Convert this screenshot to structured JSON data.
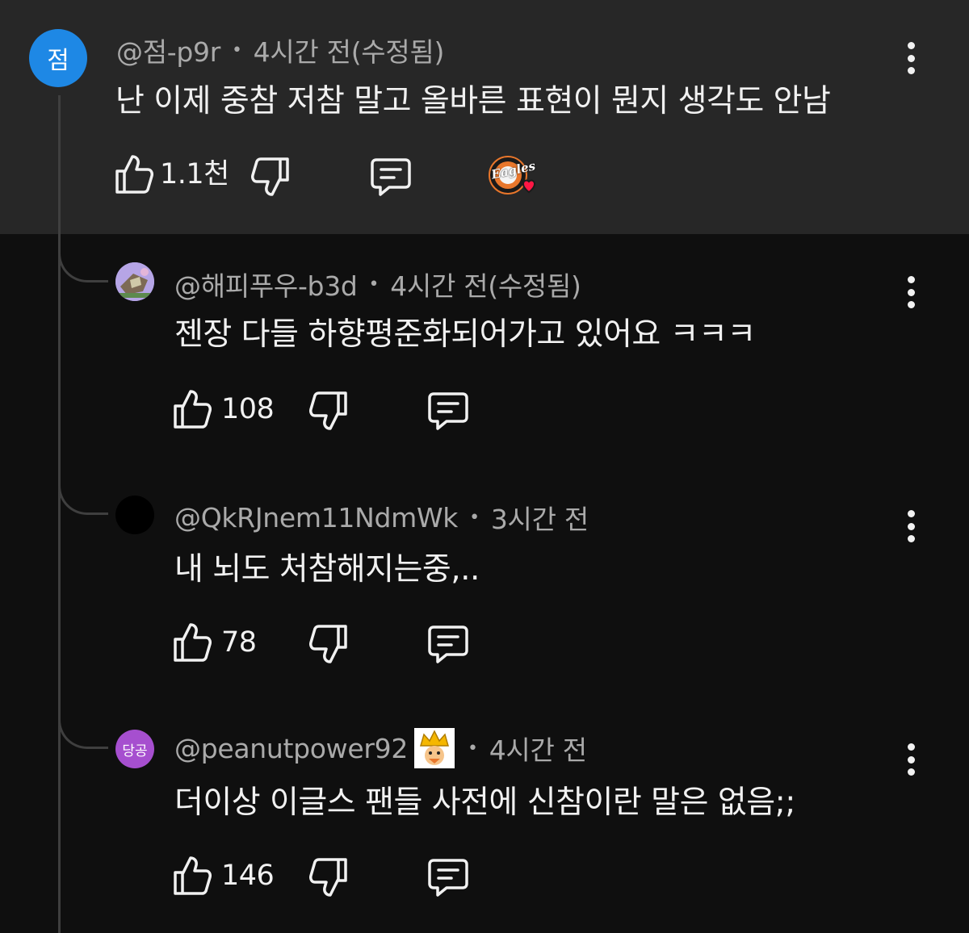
{
  "accent": "#1e88e5",
  "comments": [
    {
      "avatar_text": "점",
      "author": "@점-p9r",
      "time": "4시간 전(수정됨)",
      "text": "난 이제 중참 저참 말고 올바른 표현이 뭔지 생각도 안남",
      "likes": "1.1천",
      "creator_heart_badge": "Eagles",
      "highlighted": true
    },
    {
      "author": "@해피푸우-b3d",
      "time": "4시간 전(수정됨)",
      "text": "젠장 다들 하향평준화되어가고 있어요 ㅋㅋㅋ",
      "likes": "108"
    },
    {
      "author": "@QkRJnem11NdmWk",
      "time": "3시간 전",
      "text": "내 뇌도 처참해지는중,..",
      "likes": "78"
    },
    {
      "avatar_text": "당공",
      "author": "@peanutpower92",
      "time": "4시간 전",
      "text": "더이상 이글스 팬들 사전에 신참이란 말은 없음;;",
      "likes": "146"
    }
  ],
  "icons": {
    "like": "thumbs-up-icon",
    "dislike": "thumbs-down-icon",
    "reply": "reply-icon",
    "menu": "more-vert-icon"
  }
}
